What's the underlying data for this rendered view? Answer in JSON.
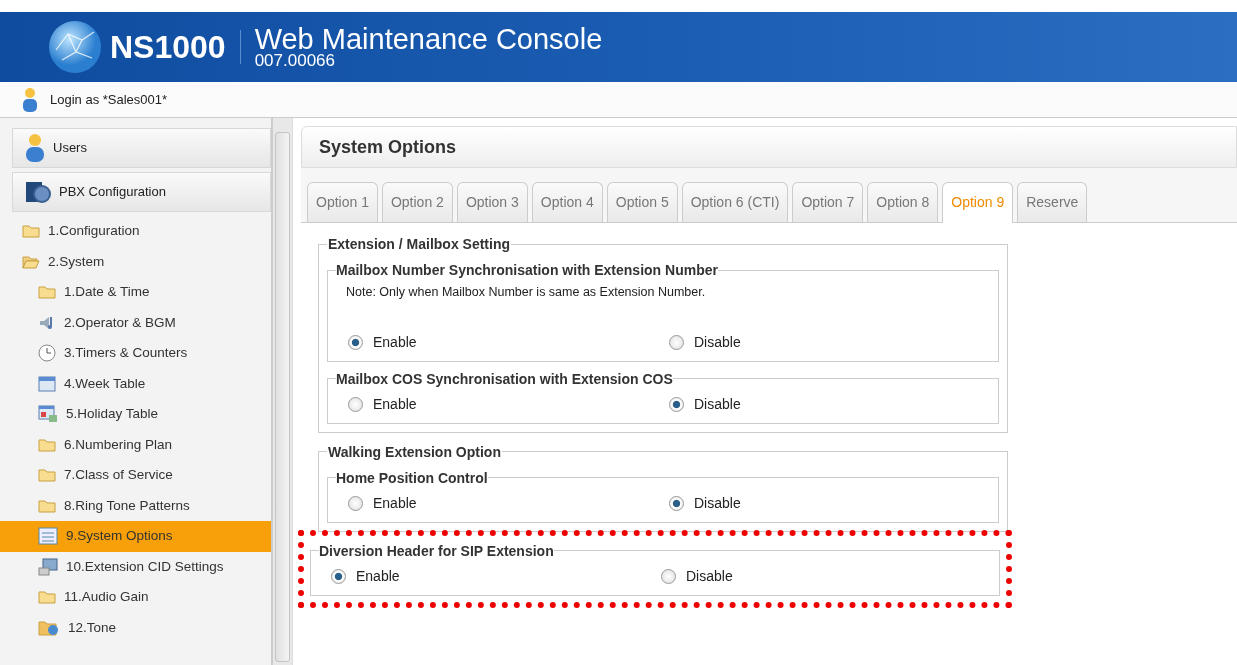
{
  "header": {
    "product": "NS1000",
    "title": "Web Maintenance Console",
    "version": "007.00066"
  },
  "login": {
    "text": "Login as *Sales001*"
  },
  "sidebar": {
    "panels": [
      {
        "label": "Users",
        "kind": "users"
      },
      {
        "label": "PBX Configuration",
        "kind": "pbx"
      }
    ],
    "tree": [
      {
        "label": "1.Configuration",
        "kind": "folder",
        "expanded": false,
        "selected": false
      },
      {
        "label": "2.System",
        "kind": "folder",
        "expanded": true,
        "selected": false,
        "children": [
          {
            "label": "1.Date & Time",
            "kind": "folder",
            "selected": false
          },
          {
            "label": "2.Operator & BGM",
            "kind": "audio",
            "selected": false
          },
          {
            "label": "3.Timers & Counters",
            "kind": "clock",
            "selected": false
          },
          {
            "label": "4.Week Table",
            "kind": "calendar",
            "selected": false
          },
          {
            "label": "5.Holiday Table",
            "kind": "table",
            "selected": false
          },
          {
            "label": "6.Numbering Plan",
            "kind": "folder",
            "selected": false
          },
          {
            "label": "7.Class of Service",
            "kind": "folder",
            "selected": false
          },
          {
            "label": "8.Ring Tone Patterns",
            "kind": "folder",
            "selected": false
          },
          {
            "label": "9.System Options",
            "kind": "options",
            "selected": true
          },
          {
            "label": "10.Extension CID Settings",
            "kind": "cid",
            "selected": false
          },
          {
            "label": "11.Audio Gain",
            "kind": "folder",
            "selected": false
          },
          {
            "label": "12.Tone",
            "kind": "tone",
            "selected": false
          }
        ]
      }
    ]
  },
  "panel": {
    "title": "System Options"
  },
  "tabs": [
    {
      "label": "Option 1",
      "selected": false
    },
    {
      "label": "Option 2",
      "selected": false
    },
    {
      "label": "Option 3",
      "selected": false
    },
    {
      "label": "Option 4",
      "selected": false
    },
    {
      "label": "Option 5",
      "selected": false
    },
    {
      "label": "Option 6 (CTI)",
      "selected": false
    },
    {
      "label": "Option 7",
      "selected": false
    },
    {
      "label": "Option 8",
      "selected": false
    },
    {
      "label": "Option 9",
      "selected": true
    },
    {
      "label": "Reserve",
      "selected": false
    }
  ],
  "sections": [
    {
      "kind": "section",
      "title": "Extension / Mailbox Setting",
      "highlighted": false,
      "groups": [
        {
          "title": "Mailbox Number Synchronisation with Extension Number",
          "note": "Note: Only when Mailbox Number is same as Extension Number.",
          "options": [
            {
              "label": "Enable",
              "selected": true
            },
            {
              "label": "Disable",
              "selected": false
            }
          ]
        },
        {
          "title": "Mailbox COS Synchronisation with Extension COS",
          "options": [
            {
              "label": "Enable",
              "selected": false
            },
            {
              "label": "Disable",
              "selected": true
            }
          ]
        }
      ]
    },
    {
      "kind": "section",
      "title": "Walking Extension Option",
      "highlighted": false,
      "groups": [
        {
          "title": "Home Position Control",
          "options": [
            {
              "label": "Enable",
              "selected": false
            },
            {
              "label": "Disable",
              "selected": true
            }
          ]
        }
      ]
    },
    {
      "kind": "group",
      "title": "Diversion Header for SIP Extension",
      "highlighted": true,
      "options": [
        {
          "label": "Enable",
          "selected": true
        },
        {
          "label": "Disable",
          "selected": false
        }
      ]
    }
  ]
}
